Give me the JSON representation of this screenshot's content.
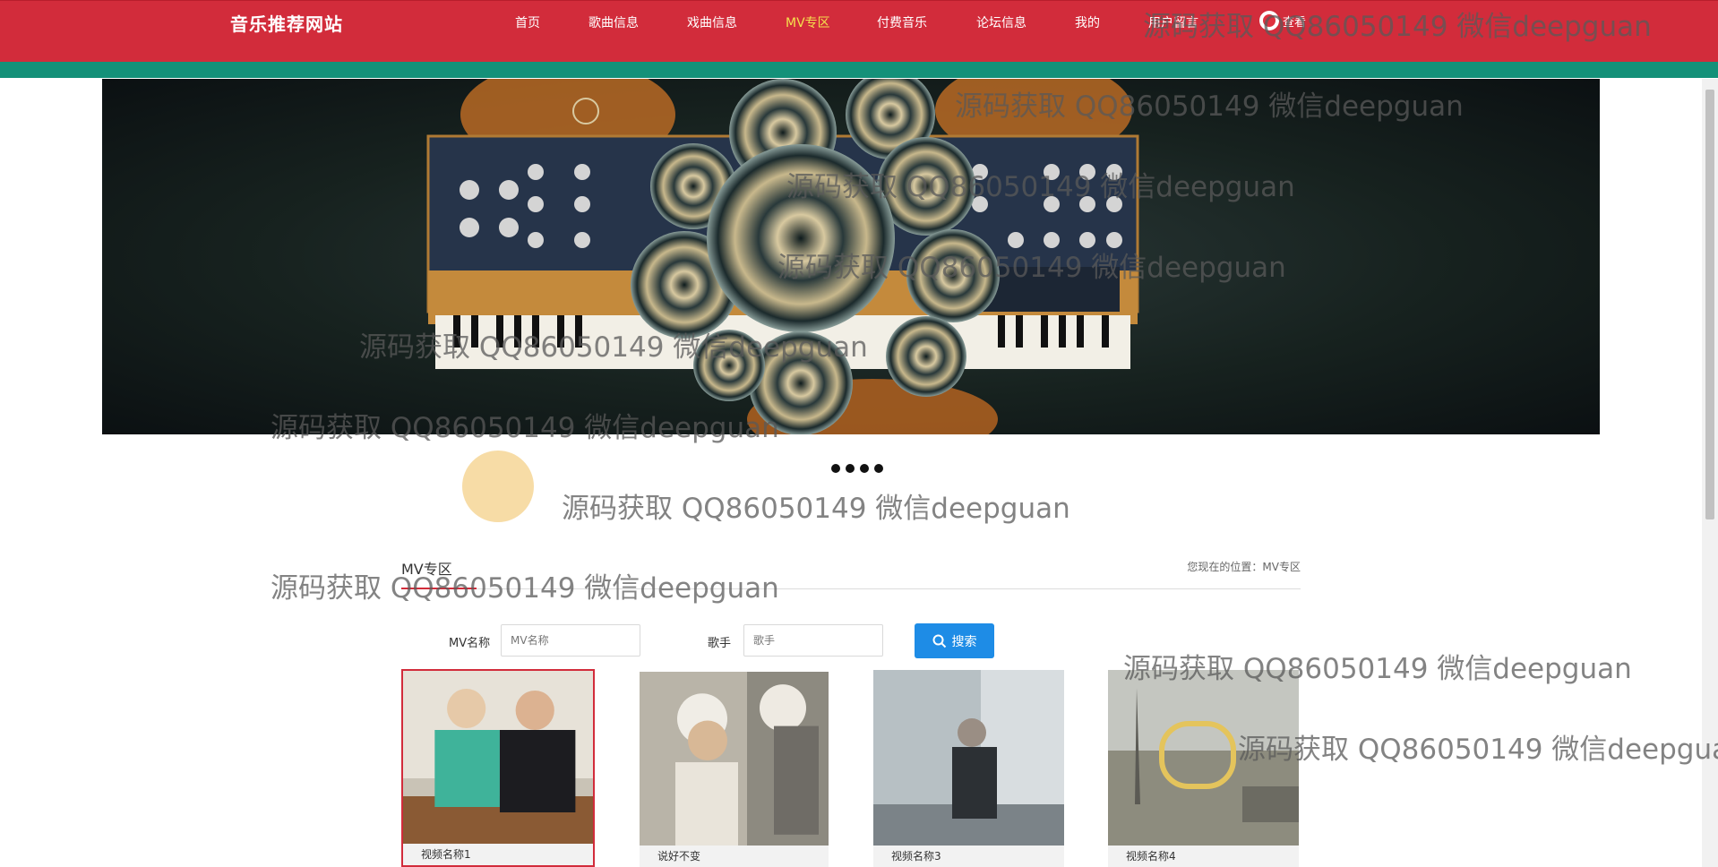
{
  "header": {
    "brand": "音乐推荐网站",
    "nav": [
      {
        "label": "首页",
        "active": false
      },
      {
        "label": "歌曲信息",
        "active": false
      },
      {
        "label": "戏曲信息",
        "active": false
      },
      {
        "label": "MV专区",
        "active": true
      },
      {
        "label": "付费音乐",
        "active": false
      },
      {
        "label": "论坛信息",
        "active": false
      },
      {
        "label": "我的",
        "active": false
      },
      {
        "label": "用户留言",
        "active": false
      }
    ],
    "user_label": "查看",
    "colors": {
      "bar": "#d22c3b",
      "stripe": "#149179",
      "active": "#f4e04d"
    }
  },
  "banner": {
    "icon": "synth-speakers-banner-image"
  },
  "carousel": {
    "dots": 4
  },
  "section": {
    "title": "MV专区",
    "breadcrumb": "您现在的位置：MV专区"
  },
  "filters": {
    "mv_name_label": "MV名称",
    "mv_name_placeholder": "MV名称",
    "singer_label": "歌手",
    "singer_placeholder": "歌手",
    "search_label": "搜索"
  },
  "cards": [
    {
      "caption": "视频名称1",
      "selected": true
    },
    {
      "caption": "说好不变",
      "selected": false
    },
    {
      "caption": "视频名称3",
      "selected": false
    },
    {
      "caption": "视频名称4",
      "selected": false
    }
  ],
  "watermarks": [
    "源码获取 QQ86050149 微信deepguan",
    "源码获取 QQ86050149 微信deepguan",
    "源码获取 QQ86050149 微信deepguan",
    "源码获取 QQ86050149 微信deepguan",
    "源码获取 QQ86050149 微信deepguan",
    "源码获取 QQ86050149 微信deepguan",
    "源码获取 QQ86050149 微信deepguan",
    "源码获取 QQ86050149 微信deepguan",
    "源码获取 QQ86050149 微信deepguan",
    "源码获取 QQ86050149 微信deepguan"
  ]
}
